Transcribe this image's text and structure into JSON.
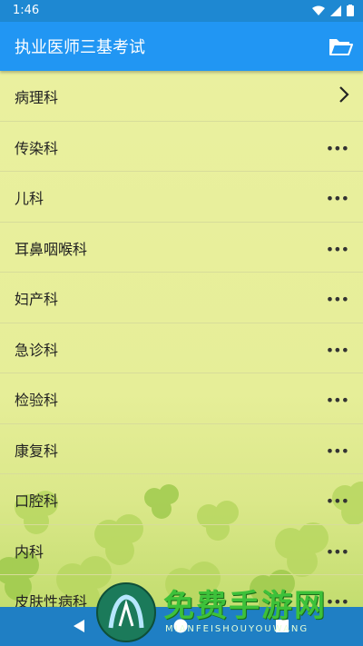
{
  "status_bar": {
    "time": "1:46"
  },
  "app_bar": {
    "title": "执业医师三基考试",
    "folder_icon": "folder-open-icon"
  },
  "items": [
    {
      "label": "病理科",
      "trail": "chevron-right-icon"
    },
    {
      "label": "传染科",
      "trail": "more-horizontal-icon",
      "more": "•••"
    },
    {
      "label": "儿科",
      "trail": "more-horizontal-icon",
      "more": "•••"
    },
    {
      "label": "耳鼻咽喉科",
      "trail": "more-horizontal-icon",
      "more": "•••"
    },
    {
      "label": "妇产科",
      "trail": "more-horizontal-icon",
      "more": "•••"
    },
    {
      "label": "急诊科",
      "trail": "more-horizontal-icon",
      "more": "•••"
    },
    {
      "label": "检验科",
      "trail": "more-horizontal-icon",
      "more": "•••"
    },
    {
      "label": "康复科",
      "trail": "more-horizontal-icon",
      "more": "•••"
    },
    {
      "label": "口腔科",
      "trail": "more-horizontal-icon",
      "more": "•••"
    },
    {
      "label": "内科",
      "trail": "more-horizontal-icon",
      "more": "•••"
    },
    {
      "label": "皮肤性病科",
      "trail": "more-horizontal-icon",
      "more": "•••"
    }
  ],
  "watermark": {
    "text": "免费手游网",
    "subtext": "MIANFEISHOUYOUWANG"
  },
  "colors": {
    "status_bar": "#1e88d2",
    "app_bar": "#2196f3",
    "list_bg": "#e9ef9a",
    "watermark": "#3dc13a"
  }
}
